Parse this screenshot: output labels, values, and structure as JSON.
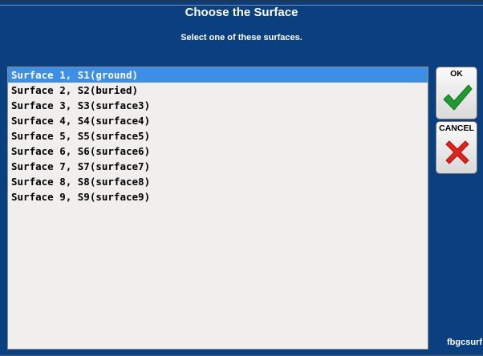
{
  "dialog": {
    "title": "Choose the Surface",
    "subtitle": "Select one of these surfaces.",
    "footer_code": "fbgcsurf",
    "background_color": "#0a3f80"
  },
  "surface_list": {
    "selected_index": 0,
    "selection_color": "#3d8fe6",
    "items": [
      "Surface 1, S1(ground)",
      "Surface 2, S2(buried)",
      "Surface 3, S3(surface3)",
      "Surface 4, S4(surface4)",
      "Surface 5, S5(surface5)",
      "Surface 6, S6(surface6)",
      "Surface 7, S7(surface7)",
      "Surface 8, S8(surface8)",
      "Surface 9, S9(surface9)"
    ]
  },
  "buttons": {
    "ok": {
      "label": "OK",
      "icon": "checkmark-icon",
      "icon_color": "#1f9a2e"
    },
    "cancel": {
      "label": "CANCEL",
      "icon": "cross-icon",
      "icon_color": "#e0231c"
    }
  }
}
